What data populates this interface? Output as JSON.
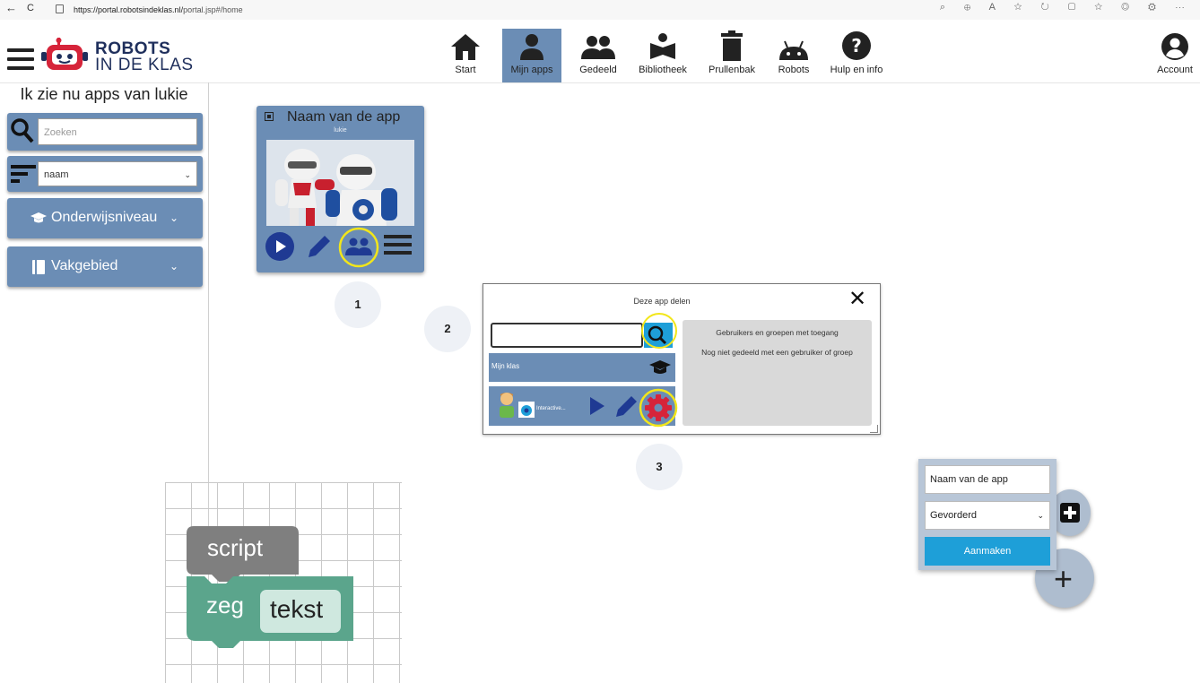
{
  "browser": {
    "back": "←",
    "reload": "C",
    "url_host": "https://portal.robotsindeklas.nl/",
    "url_path": "portal.jsp#/home"
  },
  "logo": {
    "line1": "ROBOTS",
    "line2": "IN DE KLAS"
  },
  "nav": [
    {
      "label": "Start",
      "icon": "home-icon"
    },
    {
      "label": "Mijn apps",
      "icon": "person-icon",
      "active": true
    },
    {
      "label": "Gedeeld",
      "icon": "group-icon"
    },
    {
      "label": "Bibliotheek",
      "icon": "library-icon"
    },
    {
      "label": "Prullenbak",
      "icon": "trash-icon"
    },
    {
      "label": "Robots",
      "icon": "robot-icon"
    },
    {
      "label": "Hulp en info",
      "icon": "help-icon"
    }
  ],
  "account": {
    "label": "Account",
    "icon": "account-icon"
  },
  "sidebar": {
    "title": "Ik zie nu apps van lukie",
    "search_placeholder": "Zoeken",
    "sort_value": "naam",
    "filters": [
      {
        "label": "Onderwijsniveau",
        "icon": "graduation-cap-icon"
      },
      {
        "label": "Vakgebied",
        "icon": "book-icon"
      }
    ]
  },
  "app_card": {
    "title": "Naam van de app",
    "owner": "lukie"
  },
  "steps": [
    "1",
    "2",
    "3"
  ],
  "share_dialog": {
    "title": "Deze app delen",
    "close": "✕",
    "group_label": "Mijn klas",
    "user_label": "Interactive...",
    "panel_title": "Gebruikers en groepen met toegang",
    "panel_text": "Nog niet gedeeld met een gebruiker of groep"
  },
  "blocks": {
    "script": "script",
    "say": "zeg",
    "text": "tekst"
  },
  "create_panel": {
    "name_value": "Naam van de app",
    "level_value": "Gevorderd",
    "create_button": "Aanmaken"
  },
  "colors": {
    "primary": "#6b8db5",
    "nav_dark": "#1f3a93",
    "action_blue": "#1e9fd8",
    "highlight": "#f2e61a",
    "settings_red": "#d6243a",
    "block_gray": "#7f7f7f",
    "block_green": "#5ba58c"
  }
}
